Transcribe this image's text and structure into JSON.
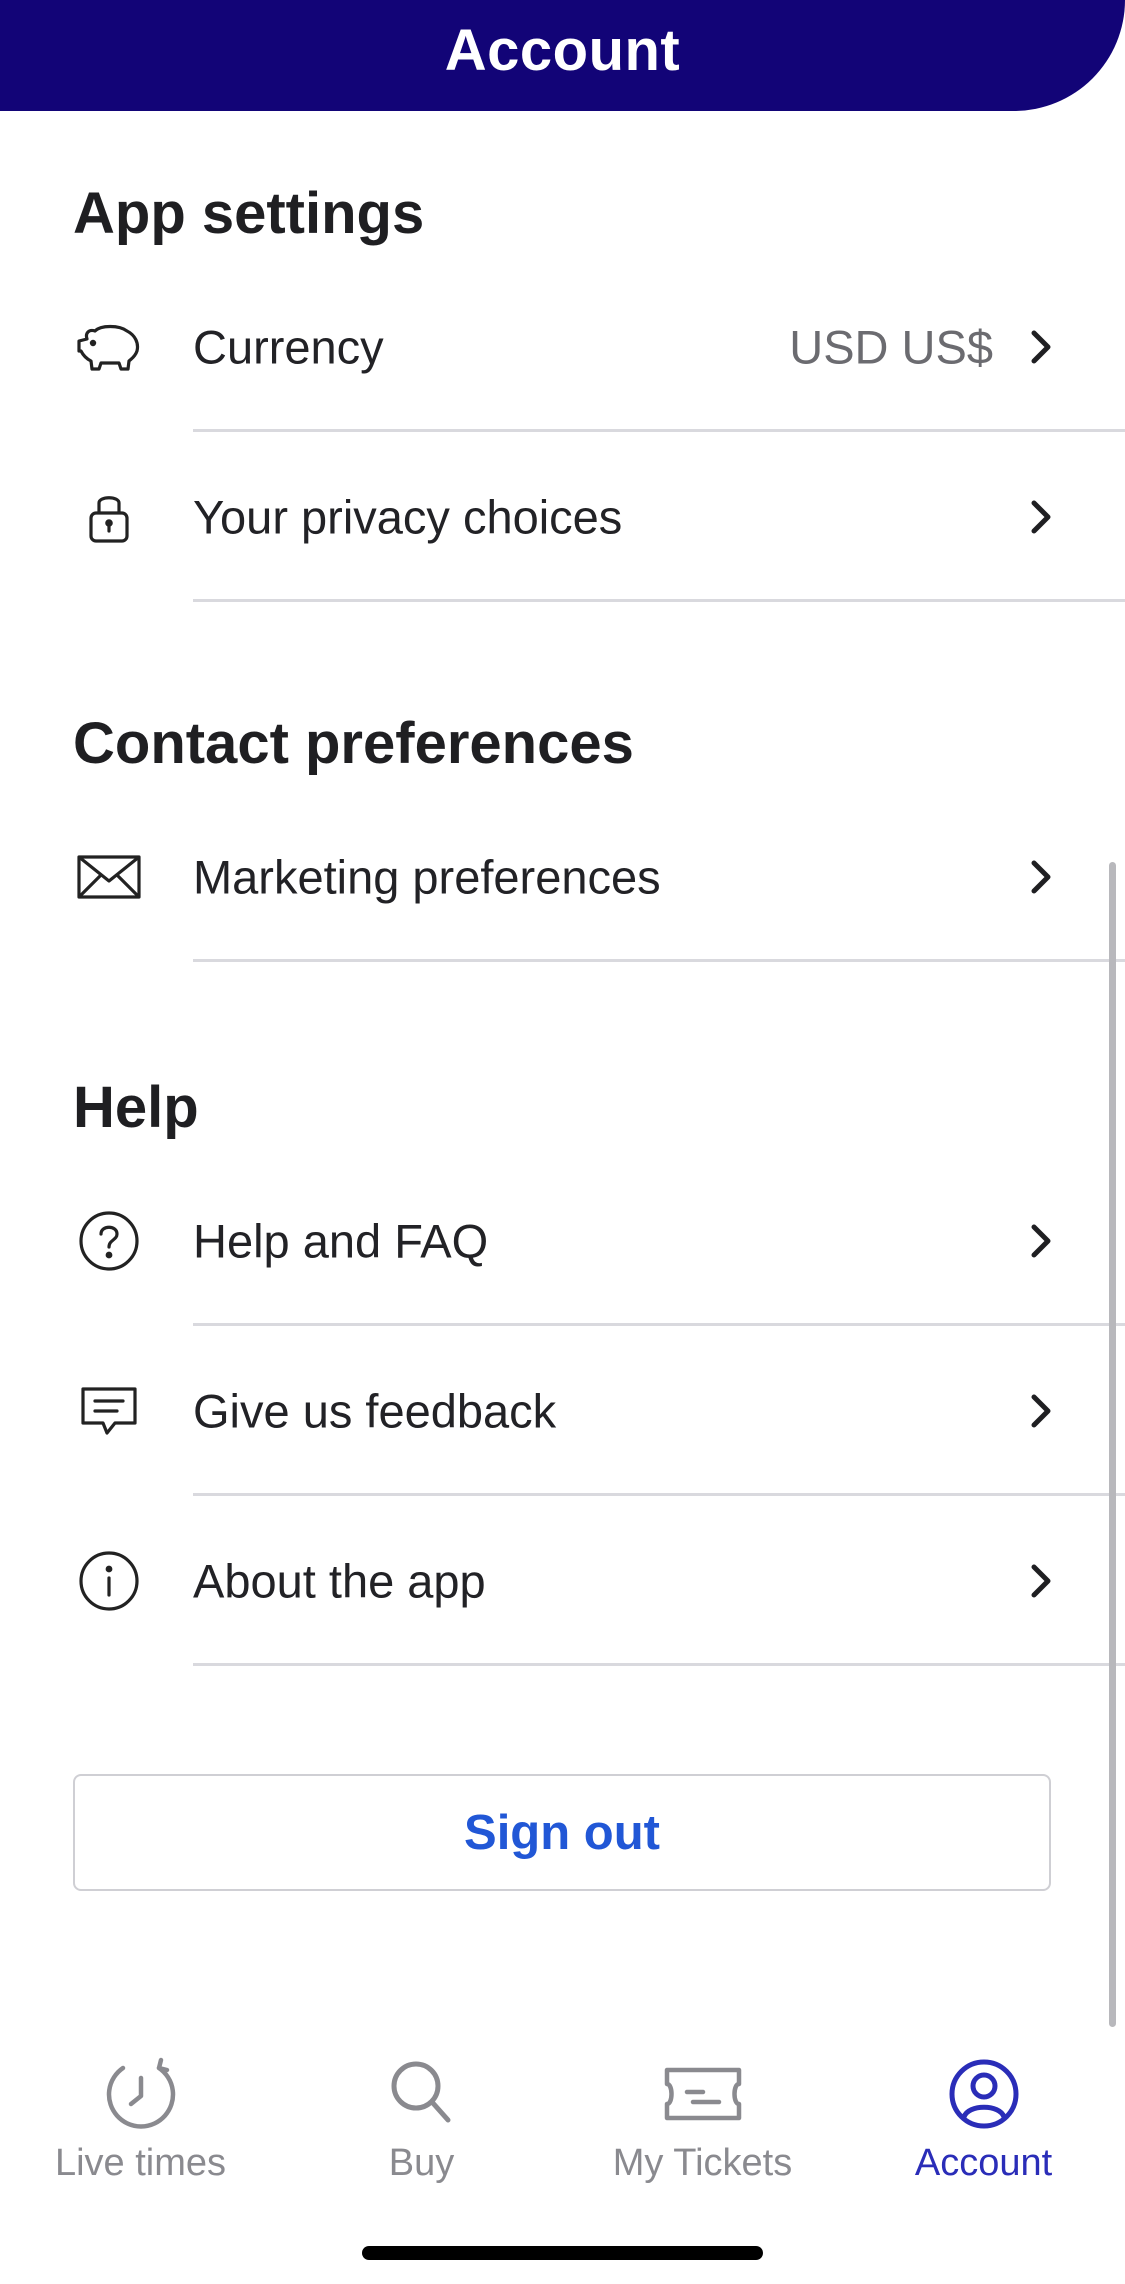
{
  "header": {
    "title": "Account"
  },
  "sections": {
    "app_settings": {
      "title": "App settings",
      "currency": {
        "icon": "piggy-bank-icon",
        "label": "Currency",
        "value": "USD US$"
      },
      "privacy": {
        "icon": "lock-icon",
        "label": "Your privacy choices"
      }
    },
    "contact": {
      "title": "Contact preferences",
      "marketing": {
        "icon": "envelope-icon",
        "label": "Marketing preferences"
      }
    },
    "help": {
      "title": "Help",
      "faq": {
        "icon": "question-circle-icon",
        "label": "Help and FAQ"
      },
      "feedback": {
        "icon": "feedback-bubble-icon",
        "label": "Give us feedback"
      },
      "about": {
        "icon": "info-circle-icon",
        "label": "About the app"
      }
    }
  },
  "sign_out": {
    "label": "Sign out"
  },
  "tabbar": {
    "items": [
      {
        "icon": "clock-icon",
        "label": "Live times",
        "active": false
      },
      {
        "icon": "search-icon",
        "label": "Buy",
        "active": false
      },
      {
        "icon": "ticket-icon",
        "label": "My Tickets",
        "active": false
      },
      {
        "icon": "account-icon",
        "label": "Account",
        "active": true
      }
    ]
  },
  "colors": {
    "header_bg": "#120477",
    "accent_blue": "#2157d6",
    "active_tab": "#2a2db8",
    "inactive_tab": "#8a8a8f"
  }
}
